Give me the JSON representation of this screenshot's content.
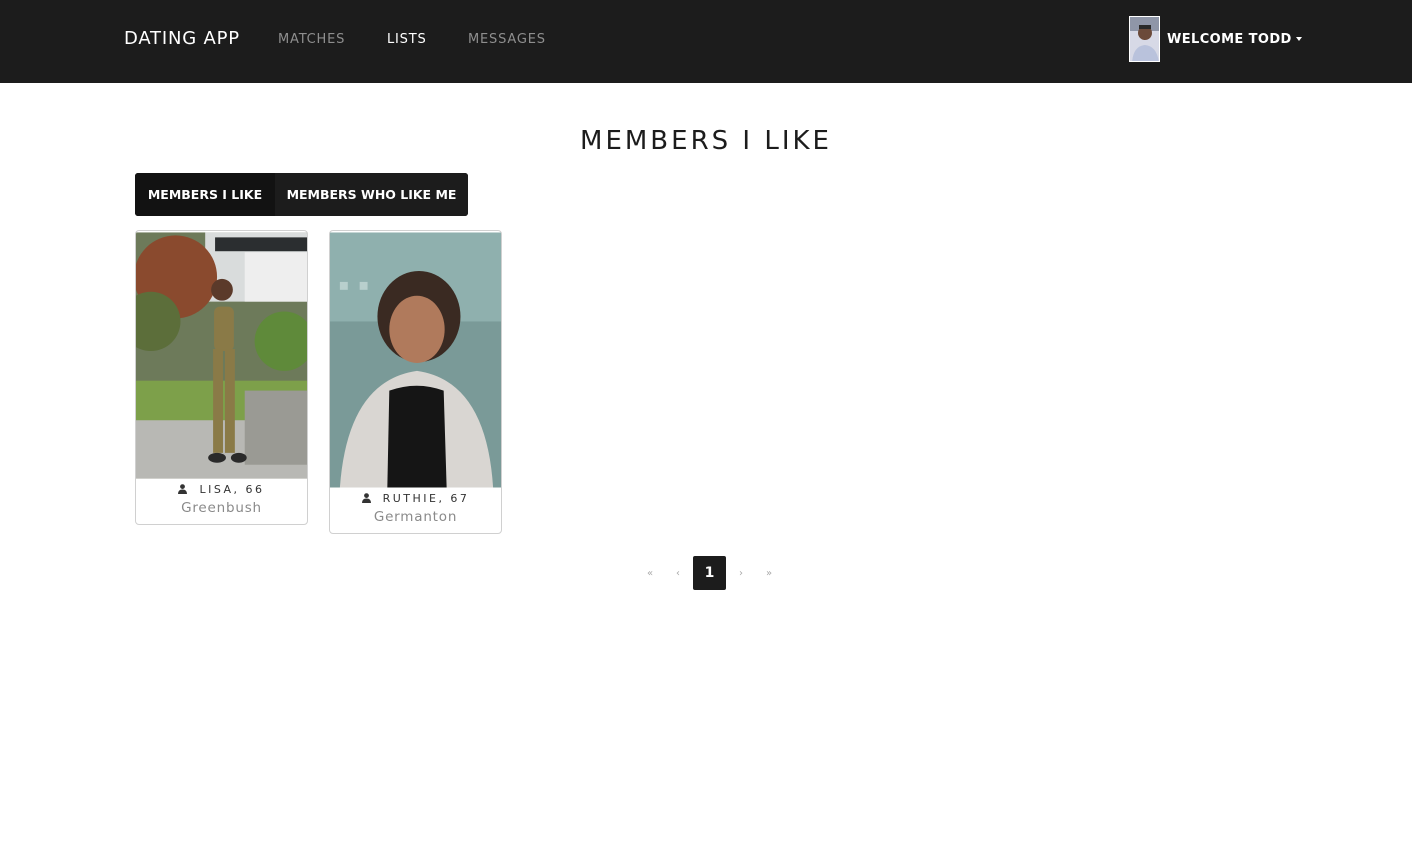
{
  "nav": {
    "brand": "DATING APP",
    "links": [
      {
        "label": "MATCHES",
        "active": false
      },
      {
        "label": "LISTS",
        "active": true
      },
      {
        "label": "MESSAGES",
        "active": false
      }
    ],
    "welcome": "WELCOME TODD",
    "avatar_icon": "user-avatar"
  },
  "page": {
    "title": "MEMBERS I LIKE"
  },
  "toggle": {
    "likes_label": "MEMBERS I LIKE",
    "liked_by_label": "MEMBERS WHO LIKE ME"
  },
  "members": [
    {
      "name": "LISA, 66",
      "city": "Greenbush"
    },
    {
      "name": "RUTHIE, 67",
      "city": "Germanton"
    }
  ],
  "pagination": {
    "first": "«",
    "prev": "‹",
    "current": "1",
    "next": "›",
    "last": "»"
  }
}
